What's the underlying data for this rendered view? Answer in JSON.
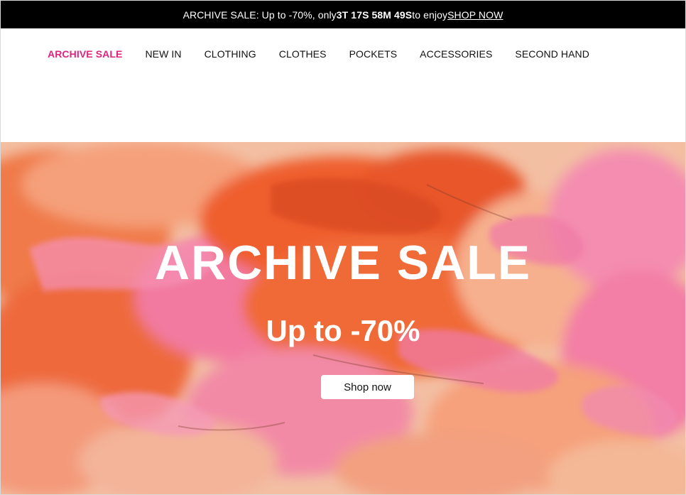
{
  "announcement": {
    "prefix": "ARCHIVE SALE: Up to -70%, only",
    "countdown": "3T 17S 58M 49S",
    "suffix": "to enjoy",
    "link_label": "SHOP NOW"
  },
  "nav": {
    "items": [
      {
        "label": "ARCHIVE SALE"
      },
      {
        "label": "NEW IN"
      },
      {
        "label": "CLOTHING"
      },
      {
        "label": "CLOTHES"
      },
      {
        "label": "POCKETS"
      },
      {
        "label": "ACCESSORIES"
      },
      {
        "label": "SECOND HAND"
      }
    ]
  },
  "hero": {
    "title": "ARCHIVE SALE",
    "subtitle": "Up to -70%",
    "button_label": "Shop now"
  },
  "colors": {
    "announcement_bg": "#000000",
    "sale_accent": "#e0247e",
    "hero_orange": "#f06a2c",
    "hero_pink": "#f27aa8",
    "hero_peach": "#f3c3a8"
  }
}
